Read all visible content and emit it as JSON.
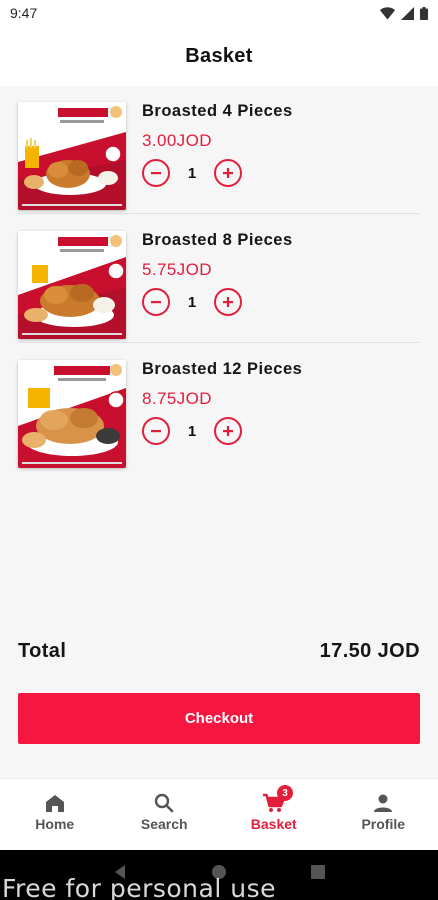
{
  "status": {
    "time": "9:47"
  },
  "header": {
    "title": "Basket"
  },
  "items": [
    {
      "name": "Broasted 4 Pieces",
      "price": "3.00JOD",
      "qty": "1"
    },
    {
      "name": "Broasted 8 Pieces",
      "price": "5.75JOD",
      "qty": "1"
    },
    {
      "name": "Broasted 12 Pieces",
      "price": "8.75JOD",
      "qty": "1"
    }
  ],
  "total": {
    "label": "Total",
    "value": "17.50 JOD"
  },
  "checkout": {
    "label": "Checkout"
  },
  "nav": {
    "items": [
      {
        "label": "Home",
        "icon": "home-icon"
      },
      {
        "label": "Search",
        "icon": "search-icon"
      },
      {
        "label": "Basket",
        "icon": "cart-icon",
        "badge": "3"
      },
      {
        "label": "Profile",
        "icon": "person-icon"
      }
    ],
    "active": "Basket"
  },
  "watermark": "Free for personal use",
  "colors": {
    "accent": "#e31e3c",
    "button": "#f5173f"
  }
}
